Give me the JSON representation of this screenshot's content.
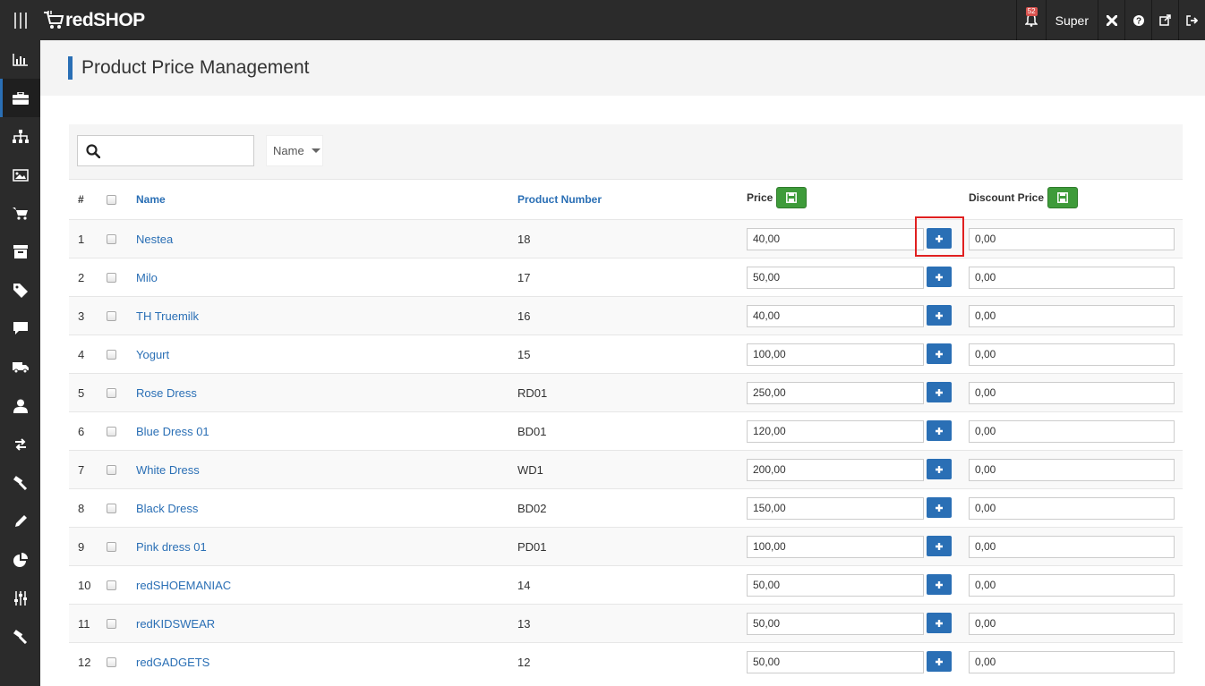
{
  "app": {
    "logo_text": "redSHOP",
    "cart_icon": "cart-icon"
  },
  "topbar": {
    "notification_count": "52",
    "user_name": "Super",
    "icons": [
      "bell-icon",
      "joomla-icon",
      "help-icon",
      "external-link-icon",
      "logout-icon"
    ]
  },
  "sidebar": {
    "items": [
      "dashboard-icon",
      "products-icon",
      "categories-icon",
      "media-icon",
      "orders-icon",
      "archive-icon",
      "tags-icon",
      "comments-icon",
      "shipping-icon",
      "users-icon",
      "import-export-icon",
      "tools-icon",
      "edit-icon",
      "statistics-icon",
      "config-icon",
      "hammer-icon"
    ],
    "active_index": 1
  },
  "page": {
    "title": "Product Price Management"
  },
  "toolbar": {
    "search_placeholder": "",
    "search_value": "",
    "sort_label": "Name"
  },
  "table": {
    "headers": {
      "num": "#",
      "name": "Name",
      "product_number": "Product Number",
      "price": "Price",
      "discount_price": "Discount Price"
    },
    "rows": [
      {
        "num": "1",
        "name": "Nestea",
        "product_number": "18",
        "price": "40,00",
        "discount": "0,00"
      },
      {
        "num": "2",
        "name": "Milo",
        "product_number": "17",
        "price": "50,00",
        "discount": "0,00"
      },
      {
        "num": "3",
        "name": "TH Truemilk",
        "product_number": "16",
        "price": "40,00",
        "discount": "0,00"
      },
      {
        "num": "4",
        "name": "Yogurt",
        "product_number": "15",
        "price": "100,00",
        "discount": "0,00"
      },
      {
        "num": "5",
        "name": "Rose Dress",
        "product_number": "RD01",
        "price": "250,00",
        "discount": "0,00"
      },
      {
        "num": "6",
        "name": "Blue Dress 01",
        "product_number": "BD01",
        "price": "120,00",
        "discount": "0,00"
      },
      {
        "num": "7",
        "name": "White Dress",
        "product_number": "WD1",
        "price": "200,00",
        "discount": "0,00"
      },
      {
        "num": "8",
        "name": "Black Dress",
        "product_number": "BD02",
        "price": "150,00",
        "discount": "0,00"
      },
      {
        "num": "9",
        "name": "Pink dress 01",
        "product_number": "PD01",
        "price": "100,00",
        "discount": "0,00"
      },
      {
        "num": "10",
        "name": "redSHOEMANIAC",
        "product_number": "14",
        "price": "50,00",
        "discount": "0,00"
      },
      {
        "num": "11",
        "name": "redKIDSWEAR",
        "product_number": "13",
        "price": "50,00",
        "discount": "0,00"
      },
      {
        "num": "12",
        "name": "redGADGETS",
        "product_number": "12",
        "price": "50,00",
        "discount": "0,00"
      }
    ]
  },
  "colors": {
    "accent": "#2a6fb5",
    "save_green": "#3e9b3a",
    "topbar": "#2b2b2b",
    "highlight": "#e02020"
  }
}
